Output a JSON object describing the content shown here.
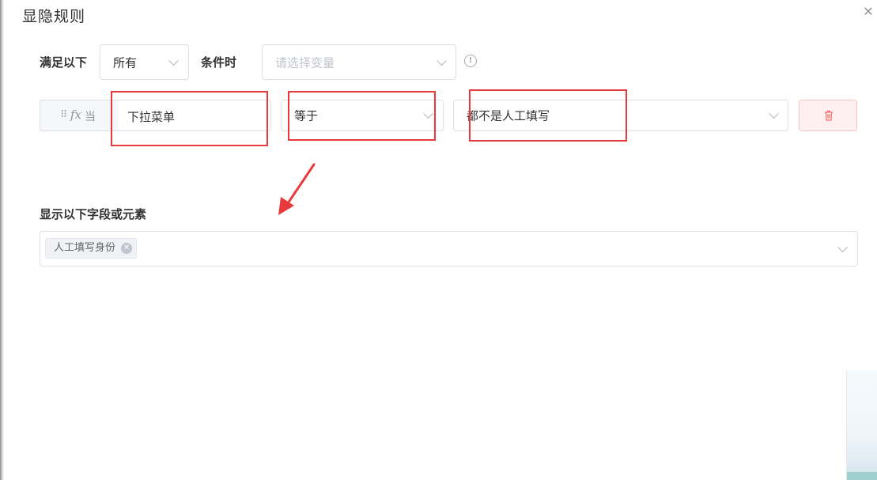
{
  "dialog": {
    "title": "显隐规则",
    "close_icon": "close-icon"
  },
  "condition_header": {
    "prefix_label": "满足以下",
    "match_select_value": "所有",
    "suffix_label": "条件时",
    "variable_placeholder": "请选择变量",
    "info_icon": "info-icon"
  },
  "condition_row": {
    "drag_icon": "drag-handle-icon",
    "fx_icon": "function-icon",
    "fx_label": "当",
    "field_value": "下拉菜单",
    "operator_value": "等于",
    "value_select": "都不是人工填写",
    "delete_icon": "trash-icon"
  },
  "display_section": {
    "label": "显示以下字段或元素",
    "tags": [
      "人工填写身份"
    ],
    "tag_close_icon": "tag-close-icon"
  },
  "annotation": {
    "highlight_color": "#e8393c",
    "arrow_icon": "red-arrow-icon"
  }
}
